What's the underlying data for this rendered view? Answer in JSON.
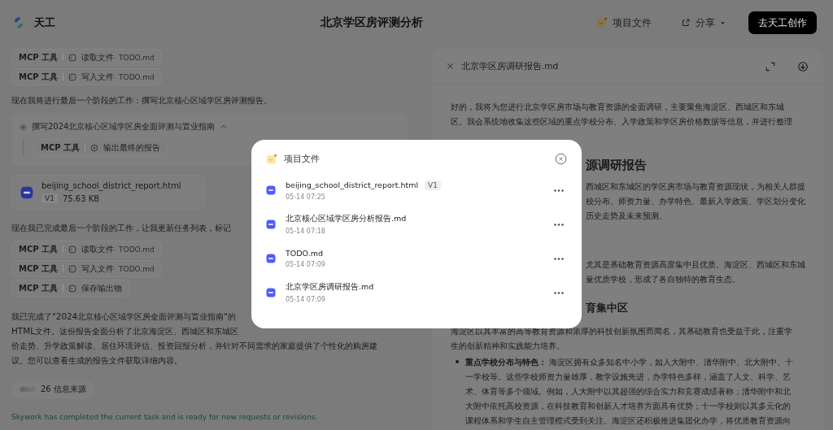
{
  "header": {
    "logo_text": "天工",
    "title": "北京学区房评测分析",
    "project_files": "项目文件",
    "share": "分享",
    "cta": "去天工创作"
  },
  "chat": [
    {
      "kind": "tool",
      "label": "MCP 工具",
      "action": "读取文件",
      "file": "TODO.md"
    },
    {
      "kind": "tool",
      "label": "MCP 工具",
      "action": "写入文件",
      "file": "TODO.md"
    },
    {
      "kind": "text",
      "lines": [
        "现在我将进行最后一个阶段的工作：撰写北京核心区域学区房评测报告。"
      ]
    },
    {
      "kind": "task",
      "title": "撰写2024北京核心区域学区房全面评测与置业指南",
      "done": true,
      "expanded": true,
      "step": {
        "label": "MCP 工具",
        "action": "输出最终的报告"
      }
    },
    {
      "kind": "file",
      "name": "beijing_school_district_report.html",
      "version": "V1",
      "size": "75.63 KB"
    },
    {
      "kind": "text",
      "lines": [
        "现在我已完成最后一个阶段的工作，让我更新任务列表，标记"
      ]
    },
    {
      "kind": "tool",
      "label": "MCP 工具",
      "action": "读取文件",
      "file": "TODO.md"
    },
    {
      "kind": "tool",
      "label": "MCP 工具",
      "action": "写入文件",
      "file": "TODO.md"
    },
    {
      "kind": "tool",
      "label": "MCP 工具",
      "action": "保存输出物"
    },
    {
      "kind": "text",
      "lines": [
        "我已完成了\"2024北京核心区域学区房全面评测与置业指南\"的",
        "HTML文件。这份报告全面分析了北京海淀区、西城区和东城区",
        "价走势、升学政策解读、居住环境评估、投资回报分析，并针对不同需求的家庭提供了个性化的购房建",
        "议。您可以查看生成的报告文件获取详细内容。"
      ]
    },
    {
      "kind": "sources",
      "label": "26 信息来源"
    },
    {
      "kind": "status",
      "text": "Skywork has completed the current task and is ready for new requests or revisions."
    }
  ],
  "document": {
    "title": "北京学区房调研报告.md",
    "blocks": [
      {
        "kind": "para",
        "cut": false,
        "lines": [
          "好的，我将为您进行北京学区房市场与教育资源的全面调研，主要聚焦海淀区、西城区和东城",
          "区。我会系统地收集这些区域的重点学校分布、入学政策和学区房价格数据等信息，并进行整理"
        ]
      },
      {
        "kind": "heading",
        "cut": true,
        "lines": [
          "源调研报告"
        ]
      },
      {
        "kind": "para",
        "cut": true,
        "lines": [
          "西城区和东城区的学区房市场与教育资源现状，为相关人群提",
          "校分布、师资力量、办学特色、最新入学政策、学区划分变化",
          "历史走势及未来预测。"
        ]
      },
      {
        "kind": "para",
        "cut": true,
        "lines": [
          "尤其是基础教育资源高度集中且优质。海淀区、西城区和东城",
          "量优质学校，形成了各自独特的教育生态。"
        ]
      },
      {
        "kind": "subheading",
        "cut": true,
        "lines": [
          "育集中区"
        ]
      },
      {
        "kind": "para",
        "cut": false,
        "lines": [
          "海淀区以其丰富的高等教育资源和浓厚的科技创新氛围而闻名，其基础教育也受益于此，注重学",
          "生的创新精神和实践能力培养。"
        ]
      },
      {
        "kind": "bullet",
        "cut": false,
        "lines": [
          "**重点学校分布与特色：** 海淀区拥有众多知名中小学，如人大附中、清华附中、北大附中、十",
          "一学校等。这些学校师资力量雄厚，教学设施先进，办学特色多样，涵盖了人文、科学、艺",
          "术、体育等多个领域。例如，人大附中以其超强的综合实力和竞赛成绩著称；清华附中和北",
          "大附中依托高校资源，在科技教育和创新人才培养方面具有优势；十一学校则以其多元化的",
          "课程体系和学生自主管理模式受到关注。海淀区还积极推进集团化办学，将优质教育资源向"
        ]
      }
    ]
  },
  "modal": {
    "title": "项目文件",
    "files": [
      {
        "name": "beijing_school_district_report.html",
        "version": "V1",
        "time": "05-14 07:25"
      },
      {
        "name": "北京核心区域学区房分析报告.md",
        "time": "05-14 07:18"
      },
      {
        "name": "TODO.md",
        "time": "05-14 07:09"
      },
      {
        "name": "北京学区房调研报告.md",
        "time": "05-14 07:09"
      }
    ]
  }
}
